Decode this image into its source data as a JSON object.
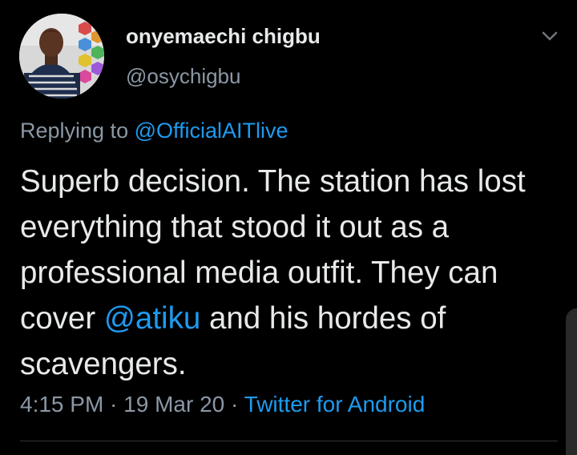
{
  "tweet": {
    "author": {
      "display_name": "onyemaechi chigbu",
      "handle": "@osychigbu"
    },
    "reply": {
      "prefix": "Replying to ",
      "mention": "@OfficialAITlive"
    },
    "body": {
      "part1": "Superb decision. The station has lost everything that stood it out as a professional media outfit. They can cover ",
      "mention": "@atiku",
      "part2": " and his hordes of scavengers."
    },
    "meta": {
      "time": "4:15 PM",
      "sep1": " · ",
      "date": "19 Mar 20",
      "sep2": " · ",
      "source": "Twitter for Android"
    },
    "icons": {
      "more_menu": "chevron-down-icon",
      "avatar": "profile-photo"
    },
    "colors": {
      "background": "#000000",
      "text": "#e7e9ea",
      "secondary": "#8b98a5",
      "link": "#1d9bf0"
    }
  }
}
